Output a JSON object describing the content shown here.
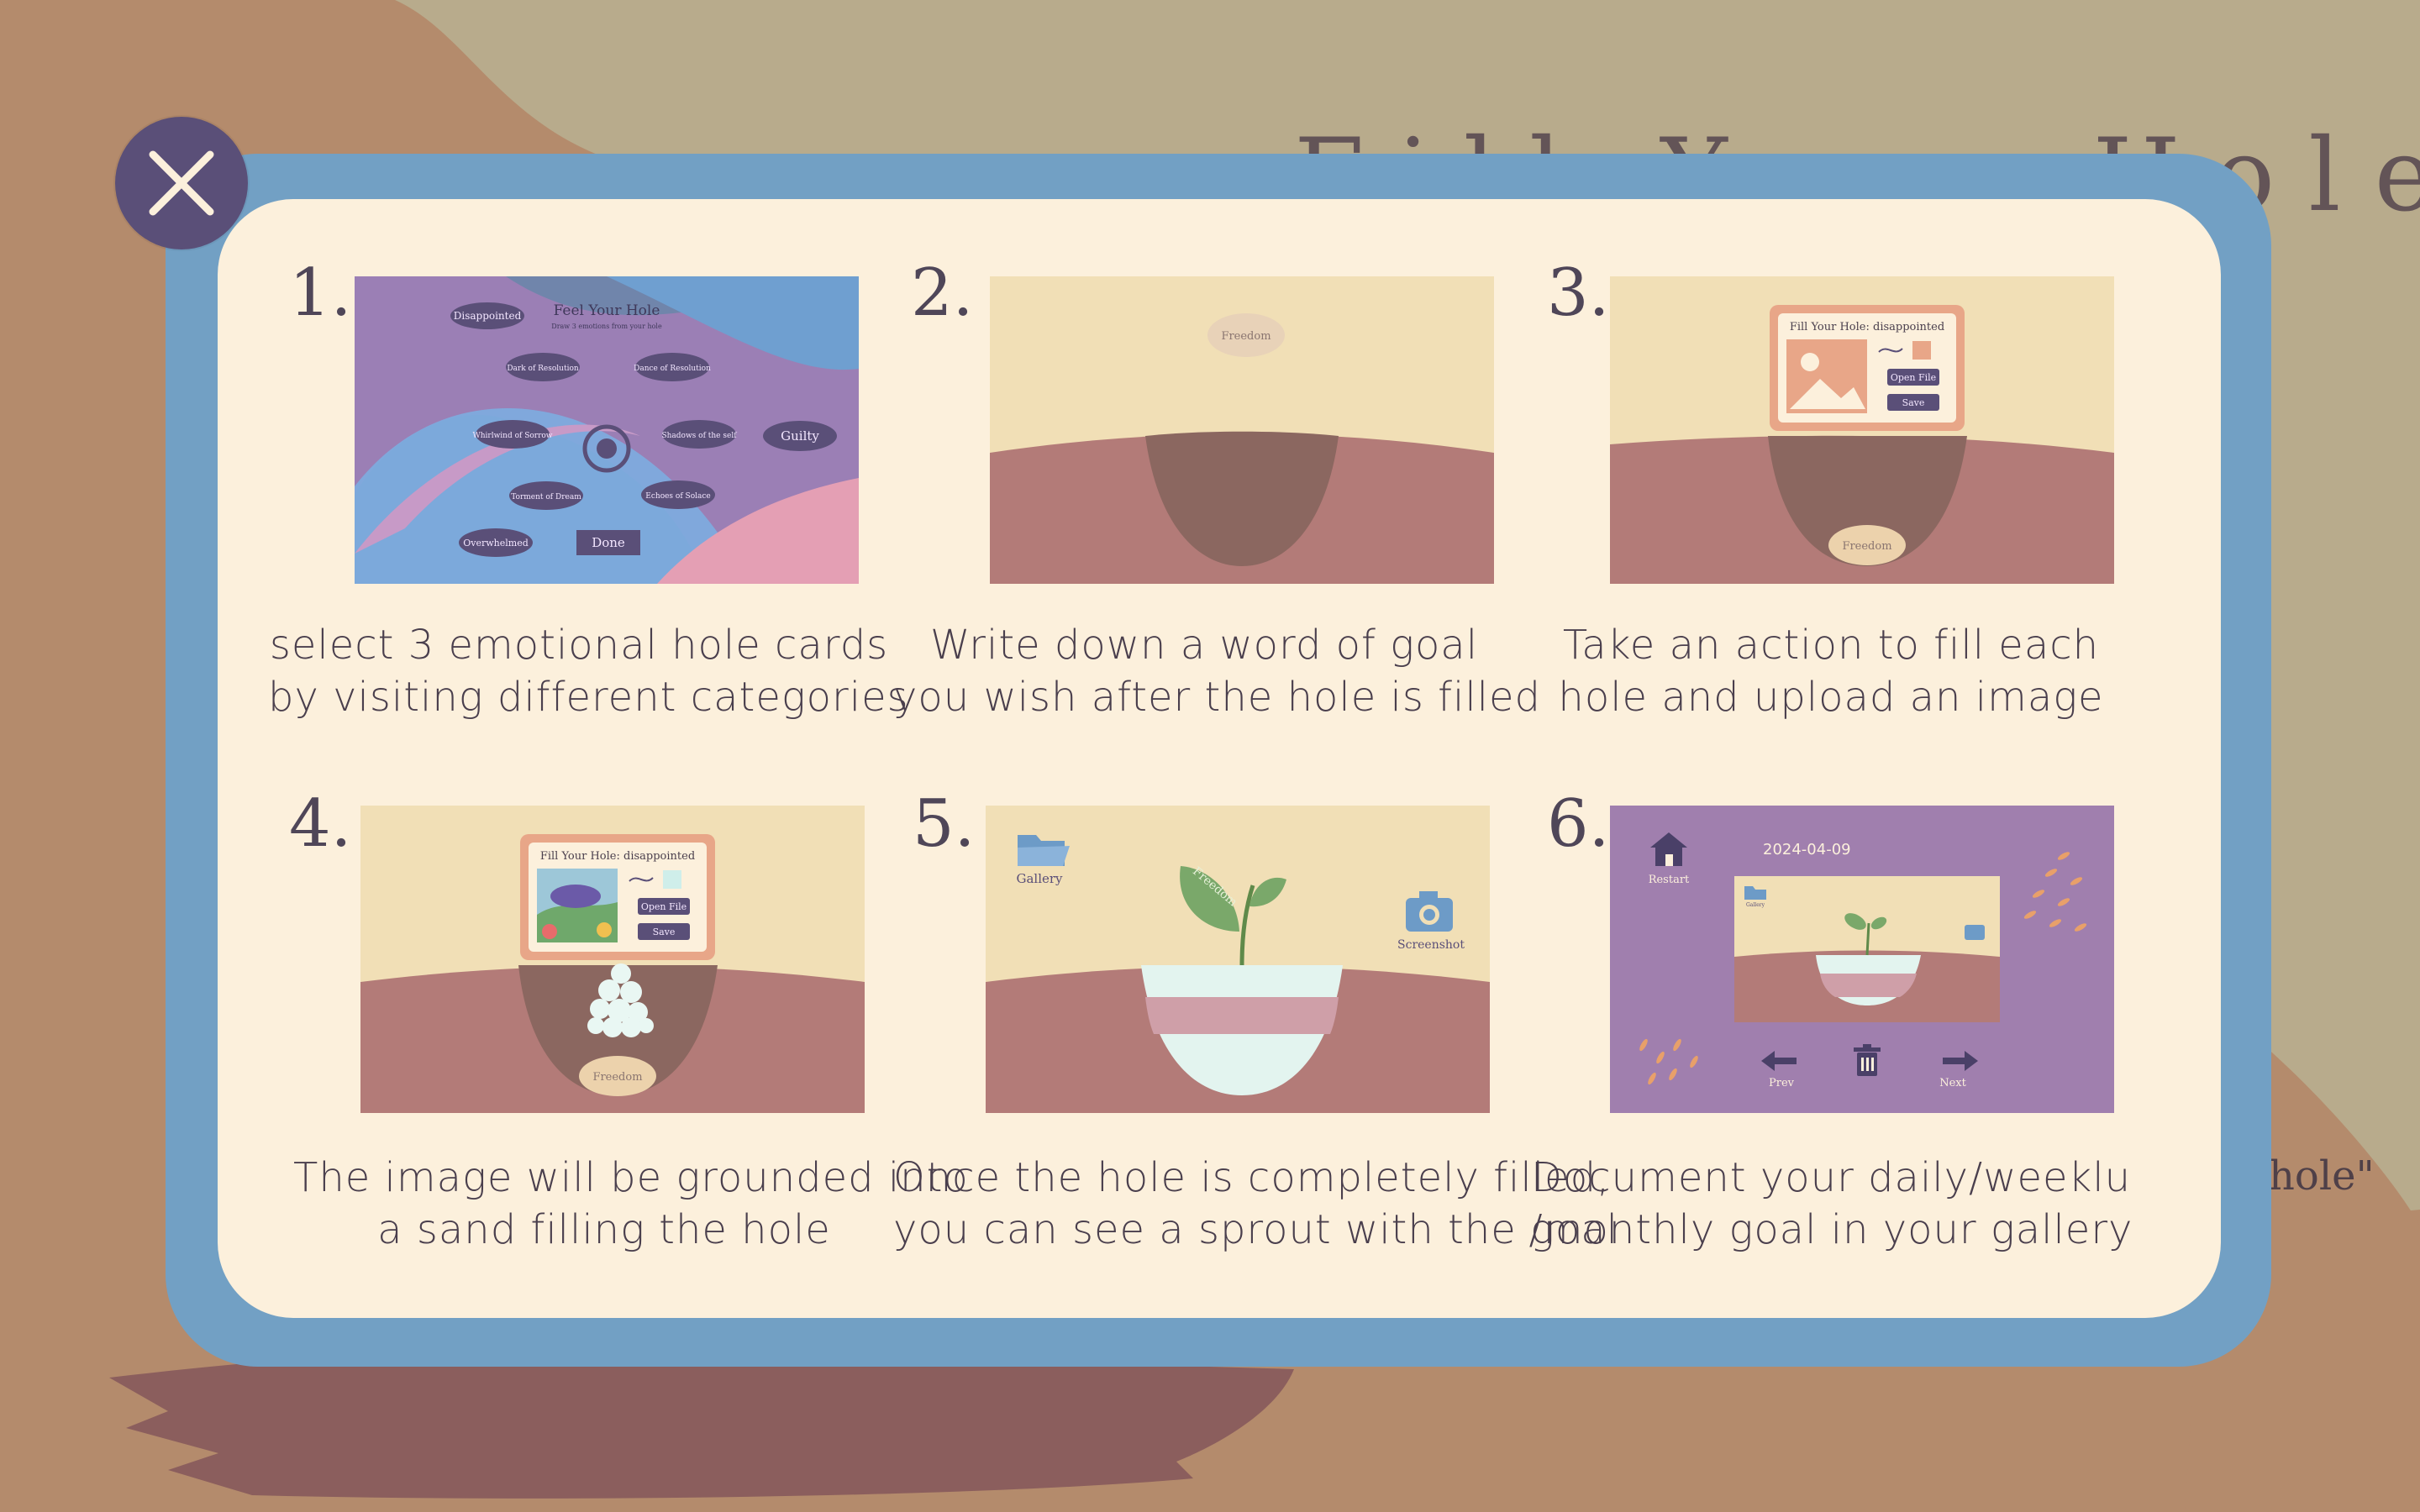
{
  "background": {
    "title": "Fill Your Hole",
    "hole_text": "hole\""
  },
  "close_button": {
    "icon": "close-icon"
  },
  "steps": [
    {
      "number": "1.",
      "caption": [
        "select 3 emotional hole cards",
        "by visiting different categories"
      ],
      "thumbnail": {
        "title": "Feel Your Hole",
        "subtitle": "Draw 3 emotions from your hole",
        "cards": [
          "Disappointed",
          "Dark of Resolution",
          "Dance of Resolution",
          "Whirlwind of Sorrow",
          "Shadows of the self",
          "Guilty",
          "Torment of Dream",
          "Echoes of Solace",
          "Overwhelmed"
        ],
        "done_label": "Done"
      }
    },
    {
      "number": "2.",
      "caption": [
        "Write down a word of goal",
        "you wish after the hole is filled"
      ],
      "thumbnail": {
        "stone_label": "Freedom"
      }
    },
    {
      "number": "3.",
      "caption": [
        "Take an action to fill each",
        "hole and upload an image"
      ],
      "thumbnail": {
        "dialog_title": "Fill Your Hole: disappointed",
        "open_file": "Open File",
        "save": "Save",
        "stone_label": "Freedom"
      }
    },
    {
      "number": "4.",
      "caption": [
        "The image will be grounded into",
        "a sand filling the hole"
      ],
      "thumbnail": {
        "dialog_title": "Fill Your Hole: disappointed",
        "open_file": "Open File",
        "save": "Save",
        "stone_label": "Freedom"
      }
    },
    {
      "number": "5.",
      "caption": [
        "Once the hole is completely filled,",
        "you can see a sprout with the goal"
      ],
      "thumbnail": {
        "gallery_label": "Gallery",
        "screenshot_label": "Screenshot",
        "leaf_label": "Freedom"
      }
    },
    {
      "number": "6.",
      "caption": [
        "Document your daily/weeklu",
        "/monthly goal in your gallery"
      ],
      "thumbnail": {
        "date": "2024-04-09",
        "restart_label": "Restart",
        "prev_label": "Prev",
        "next_label": "Next",
        "gallery_label": "Gallery"
      }
    }
  ],
  "colors": {
    "sand": "#b8ab8c",
    "brown": "#b48b6c",
    "frame_blue": "#72a0c4",
    "panel": "#fcf0dc",
    "close_purple": "#5a4f78",
    "soil": "#b37b78",
    "hole": "#8b6760",
    "sky": "#f1dfb6"
  }
}
